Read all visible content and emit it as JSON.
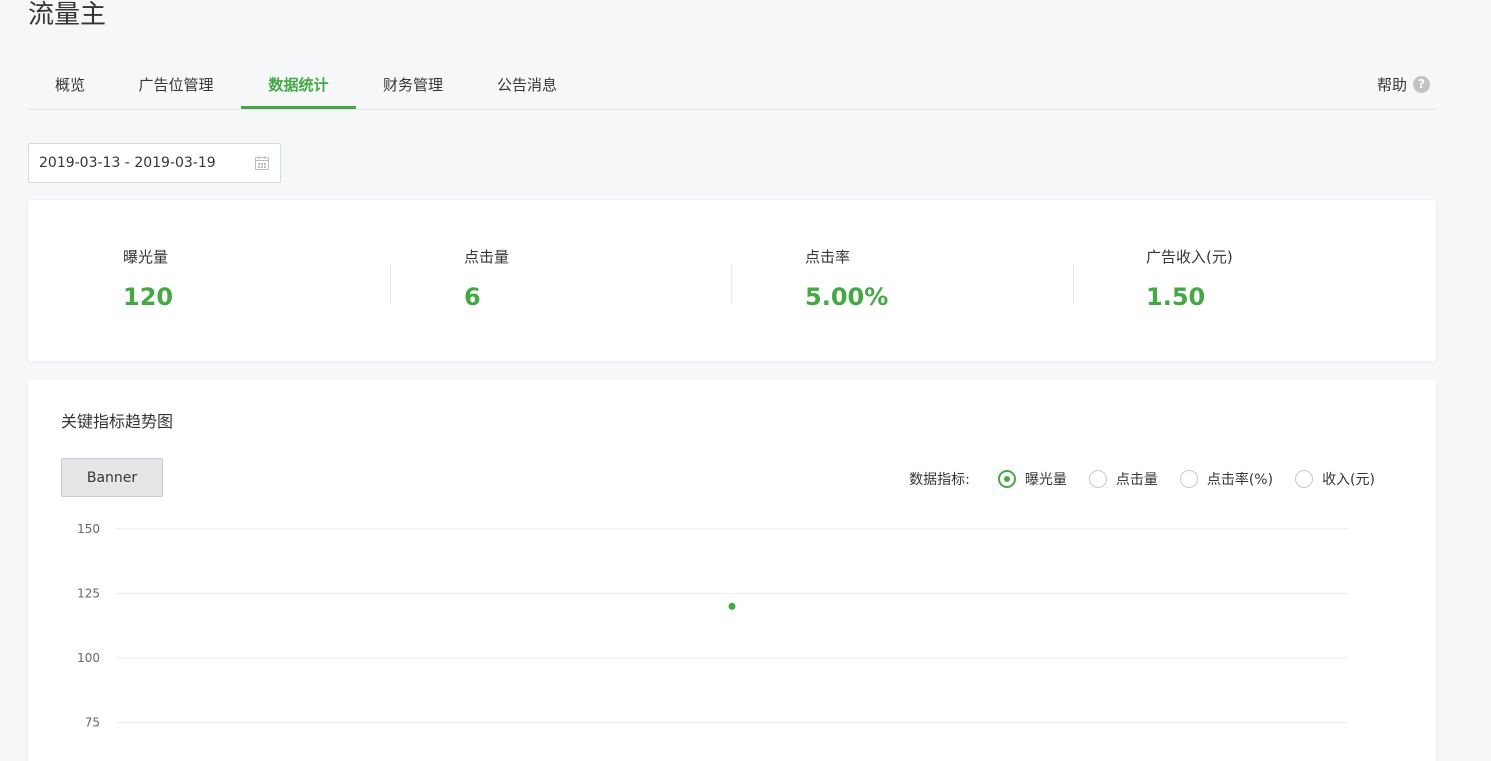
{
  "header": {
    "title": "流量主"
  },
  "tabs": [
    {
      "label": "概览",
      "active": false
    },
    {
      "label": "广告位管理",
      "active": false
    },
    {
      "label": "数据统计",
      "active": true
    },
    {
      "label": "财务管理",
      "active": false
    },
    {
      "label": "公告消息",
      "active": false
    }
  ],
  "help": {
    "label": "帮助",
    "icon": "help-circle-icon"
  },
  "date_range": {
    "value": "2019-03-13 - 2019-03-19",
    "icon": "calendar-icon"
  },
  "stats": [
    {
      "label": "曝光量",
      "value": "120"
    },
    {
      "label": "点击量",
      "value": "6"
    },
    {
      "label": "点击率",
      "value": "5.00%"
    },
    {
      "label": "广告收入(元)",
      "value": "1.50"
    }
  ],
  "trend": {
    "title": "关键指标趋势图",
    "banner_button": "Banner",
    "metrics_label": "数据指标:",
    "metric_options": [
      {
        "label": "曝光量",
        "checked": true
      },
      {
        "label": "点击量",
        "checked": false
      },
      {
        "label": "点击率(%)",
        "checked": false
      },
      {
        "label": "收入(元)",
        "checked": false
      }
    ]
  },
  "colors": {
    "accent": "#44a845",
    "text": "#353535",
    "background": "#f6f7f9"
  },
  "chart_data": {
    "type": "line",
    "y_ticks": [
      "150",
      "125",
      "100",
      "75"
    ],
    "ylim": [
      75,
      150
    ],
    "grid": true,
    "series": [
      {
        "x_index": 0,
        "values": [
          120
        ]
      }
    ],
    "color": "#44a845"
  }
}
